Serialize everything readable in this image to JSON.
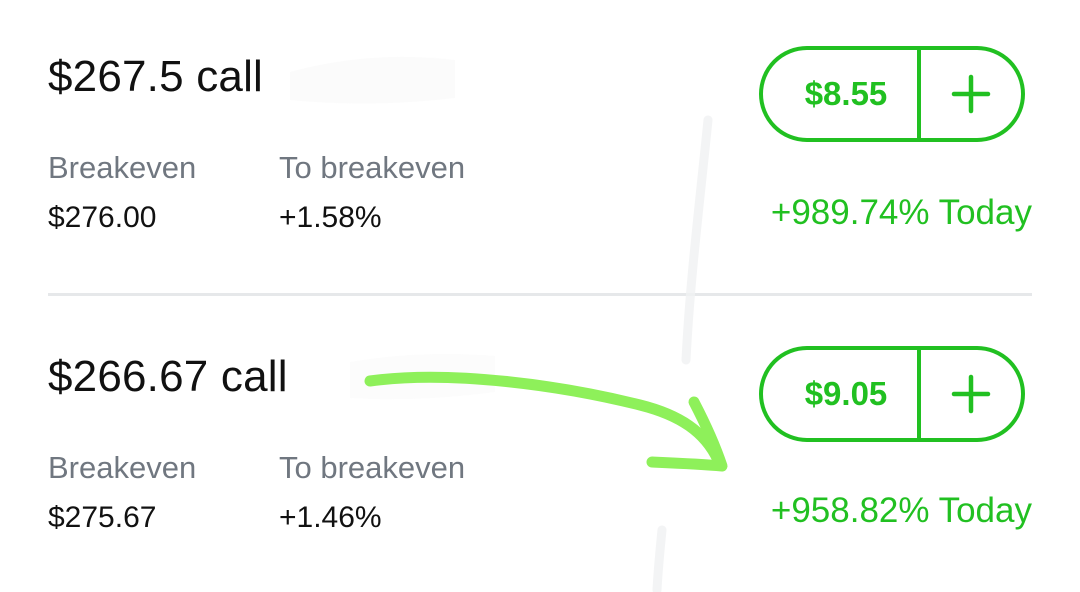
{
  "positions": [
    {
      "title": "$267.5 call",
      "breakeven_label": "Breakeven",
      "breakeven_value": "$276.00",
      "to_breakeven_label": "To breakeven",
      "to_breakeven_value": "+1.58%",
      "price_button": "$8.55",
      "today_change": "+989.74% Today"
    },
    {
      "title": "$266.67 call",
      "breakeven_label": "Breakeven",
      "breakeven_value": "$275.67",
      "to_breakeven_label": "To breakeven",
      "to_breakeven_value": "+1.46%",
      "price_button": "$9.05",
      "today_change": "+958.82% Today"
    }
  ],
  "icons": {
    "add": "plus-icon"
  },
  "colors": {
    "accent_green": "#21c021",
    "label_gray": "#707780",
    "text_primary": "#111111",
    "divider": "#e6e8ea",
    "annotation_arrow": "#8ef05a"
  }
}
